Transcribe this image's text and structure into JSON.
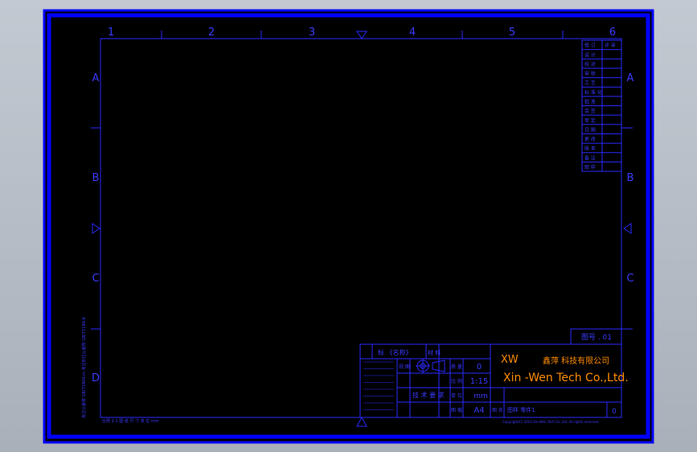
{
  "colors": {
    "background": "#b8bec7",
    "frame": "#0000ff",
    "line": "#2a2aff",
    "text": "#3a3aff",
    "accent": "#ff8c00"
  },
  "grid": {
    "columns": [
      "1",
      "2",
      "3",
      "4",
      "5",
      "6"
    ],
    "rows": [
      "A",
      "B",
      "C",
      "D"
    ]
  },
  "revision_table": {
    "header": [
      "修 订",
      "评 审"
    ],
    "rows": [
      "设 计",
      "校 对",
      "审 核",
      "工 艺",
      "标 准 化",
      "批 准",
      "会 签",
      "审 定",
      "日 期",
      "更 改",
      "版 本",
      "备 注",
      "图 样"
    ]
  },
  "stamp_label": "图号 . 01",
  "title_block": {
    "header_left": "标 《名称》",
    "header_right": "材 料",
    "mark": "0",
    "scale": "1:15",
    "unit": "mm",
    "size": "A4",
    "label_mass": "质 量",
    "label_scale": "比 例",
    "label_unit": "单 位",
    "label_size": "图 幅",
    "projection_label": "视 图",
    "mid_label": "技 术 要 求",
    "drawing_name_label": "图 名",
    "drawing_name": "图样 零件1",
    "sheet_number": "0",
    "company_code": "XW",
    "company_cn": "鑫萍 科技有限公司",
    "company_en": "Xin -Wen Tech Co.,Ltd.",
    "footer_note": "Copyright(C) 2023 Xin-Wen Tech Co.,Ltd. All rights reserved"
  },
  "left_margin_note": "未注公差按 GB/T1804-m 未注形位公差按 GB/T1184-K",
  "bottom_note": "比例 1:1 图 纸 尺 寸 单 位 mm"
}
